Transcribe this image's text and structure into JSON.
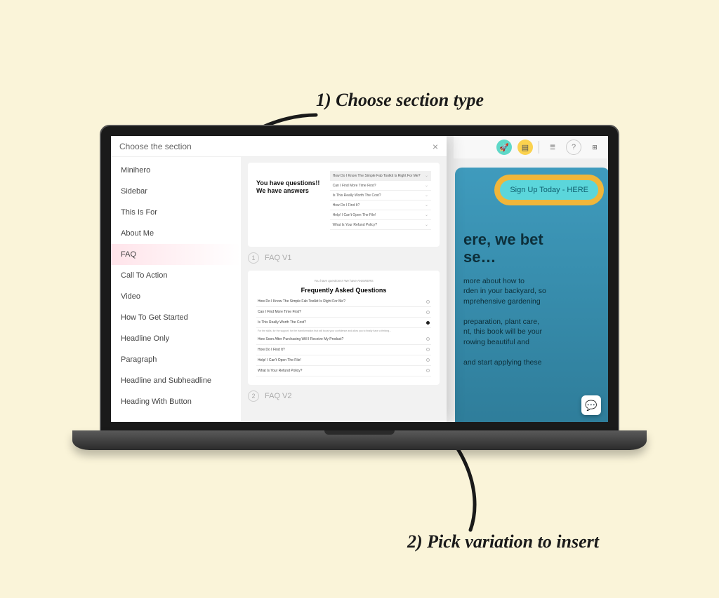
{
  "annotations": {
    "step1": "1) Choose section type",
    "step2": "2) Pick variation to insert"
  },
  "modal": {
    "title": "Choose the section",
    "close": "×",
    "sections": [
      "Minihero",
      "Sidebar",
      "This Is For",
      "About Me",
      "FAQ",
      "Call To Action",
      "Video",
      "How To Get Started",
      "Headline Only",
      "Paragraph",
      "Headline and Subheadline",
      "Heading With Button"
    ],
    "activeSection": "FAQ",
    "variations": {
      "v1": {
        "num": "1",
        "label": "FAQ V1",
        "heading": "You have questions!! We have answers",
        "items": [
          "How Do I Know The Simple Fab Toolkit Is Right For Me?",
          "Can I Find More Time First?",
          "Is This Really Worth The Cost?",
          "How Do I Find It?",
          "Help! I Can't Open The File!",
          "What Is Your Refund Policy?"
        ]
      },
      "v2": {
        "num": "2",
        "label": "FAQ V2",
        "subtitle": "You have questions!! We have ANSWERS",
        "heading": "Frequently Asked Questions",
        "items": [
          "How Do I Know The Simple Fab Toolkit Is Right For Me?",
          "Can I Find More Time First?",
          "Is This Really Worth The Cost?",
          "How Soon After Purchasing Will I Receive My Product?",
          "How Do I Find It?",
          "Help! I Can't Open The File!",
          "What Is Your Refund Policy?"
        ],
        "expandedText": "For the skills, for the support, for the transformation that will boost your confidence and allow you to finally have a thriving..."
      }
    }
  },
  "background_app": {
    "pill": "Sign Up Today - HERE",
    "headline_1": "ere, we bet",
    "headline_2": "se…",
    "body_1": "more about how to",
    "body_2": "rden in your backyard, so",
    "body_3": "mprehensive gardening",
    "body_4": "preparation, plant care,",
    "body_5": "nt, this book will be your",
    "body_6": "rowing beautiful and",
    "body_7": "and start applying these"
  },
  "icons": {
    "rocket": "🚀",
    "doc": "▤",
    "help": "?",
    "grid": "⊞",
    "chat": "💬"
  }
}
